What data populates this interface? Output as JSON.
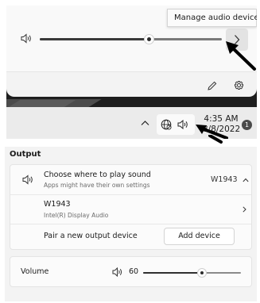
{
  "quick_settings": {
    "tooltip": "Manage audio devices",
    "volume_level_percent": 60,
    "icons": {
      "speaker": "speaker-icon",
      "chevron": "chevron-right-icon",
      "edit": "pencil-icon",
      "settings": "gear-icon"
    }
  },
  "taskbar": {
    "time": "4:35 AM",
    "date": "8/8/2022",
    "notification_count": "1",
    "icons": {
      "overflow": "chevron-up-icon",
      "network": "globe-icon",
      "volume": "speaker-icon"
    }
  },
  "settings": {
    "section_title": "Output",
    "choose_title": "Choose where to play sound",
    "choose_subtitle": "Apps might have their own settings",
    "selected_device": "W1943",
    "device_name": "W1943",
    "device_description": "Intel(R) Display Audio",
    "pair_label": "Pair a new output device",
    "add_device_label": "Add device",
    "volume_label": "Volume",
    "volume_value": "60",
    "volume_level_percent": 60
  },
  "colors": {
    "dark_background": "#1e1e1e",
    "panel": "#f3f3f3",
    "card": "#fbfbfb",
    "annotation_arrow": "#000000"
  }
}
